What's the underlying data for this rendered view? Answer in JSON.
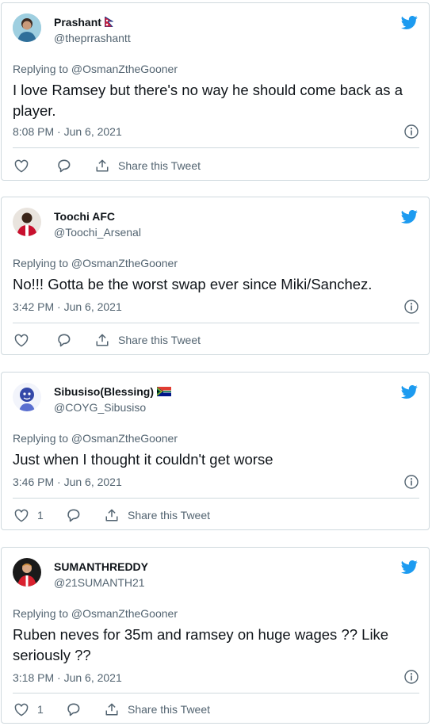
{
  "share_label": "Share this Tweet",
  "colors": {
    "twitter_blue": "#1d9bf0",
    "text_secondary": "#536471",
    "border": "#cfd9de"
  },
  "tweets": [
    {
      "name": "Prashant",
      "flag": "nepal-flag",
      "handle": "@theprrashantt",
      "replying_to": "Replying to @OsmanZtheGooner",
      "text": "I love Ramsey but there's no way he should come back as a player.",
      "time": "8:08 PM · Jun 6, 2021",
      "likes": ""
    },
    {
      "name": "Toochi AFC",
      "flag": "",
      "handle": "@Toochi_Arsenal",
      "replying_to": "Replying to @OsmanZtheGooner",
      "text": "No!!! Gotta be the worst swap ever since Miki/Sanchez.",
      "time": "3:42 PM · Jun 6, 2021",
      "likes": ""
    },
    {
      "name": "Sibusiso(Blessing)",
      "flag": "south-africa-flag",
      "handle": "@COYG_Sibusiso",
      "replying_to": "Replying to @OsmanZtheGooner",
      "text": "Just when I thought it couldn't get worse",
      "time": "3:46 PM · Jun 6, 2021",
      "likes": "1"
    },
    {
      "name": "SUMANTHREDDY",
      "flag": "",
      "handle": "@21SUMANTH21",
      "replying_to": "Replying to @OsmanZtheGooner",
      "text": "Ruben neves for 35m and ramsey on huge wages ?? Like seriously ??",
      "time": "3:18 PM · Jun 6, 2021",
      "likes": "1"
    }
  ]
}
